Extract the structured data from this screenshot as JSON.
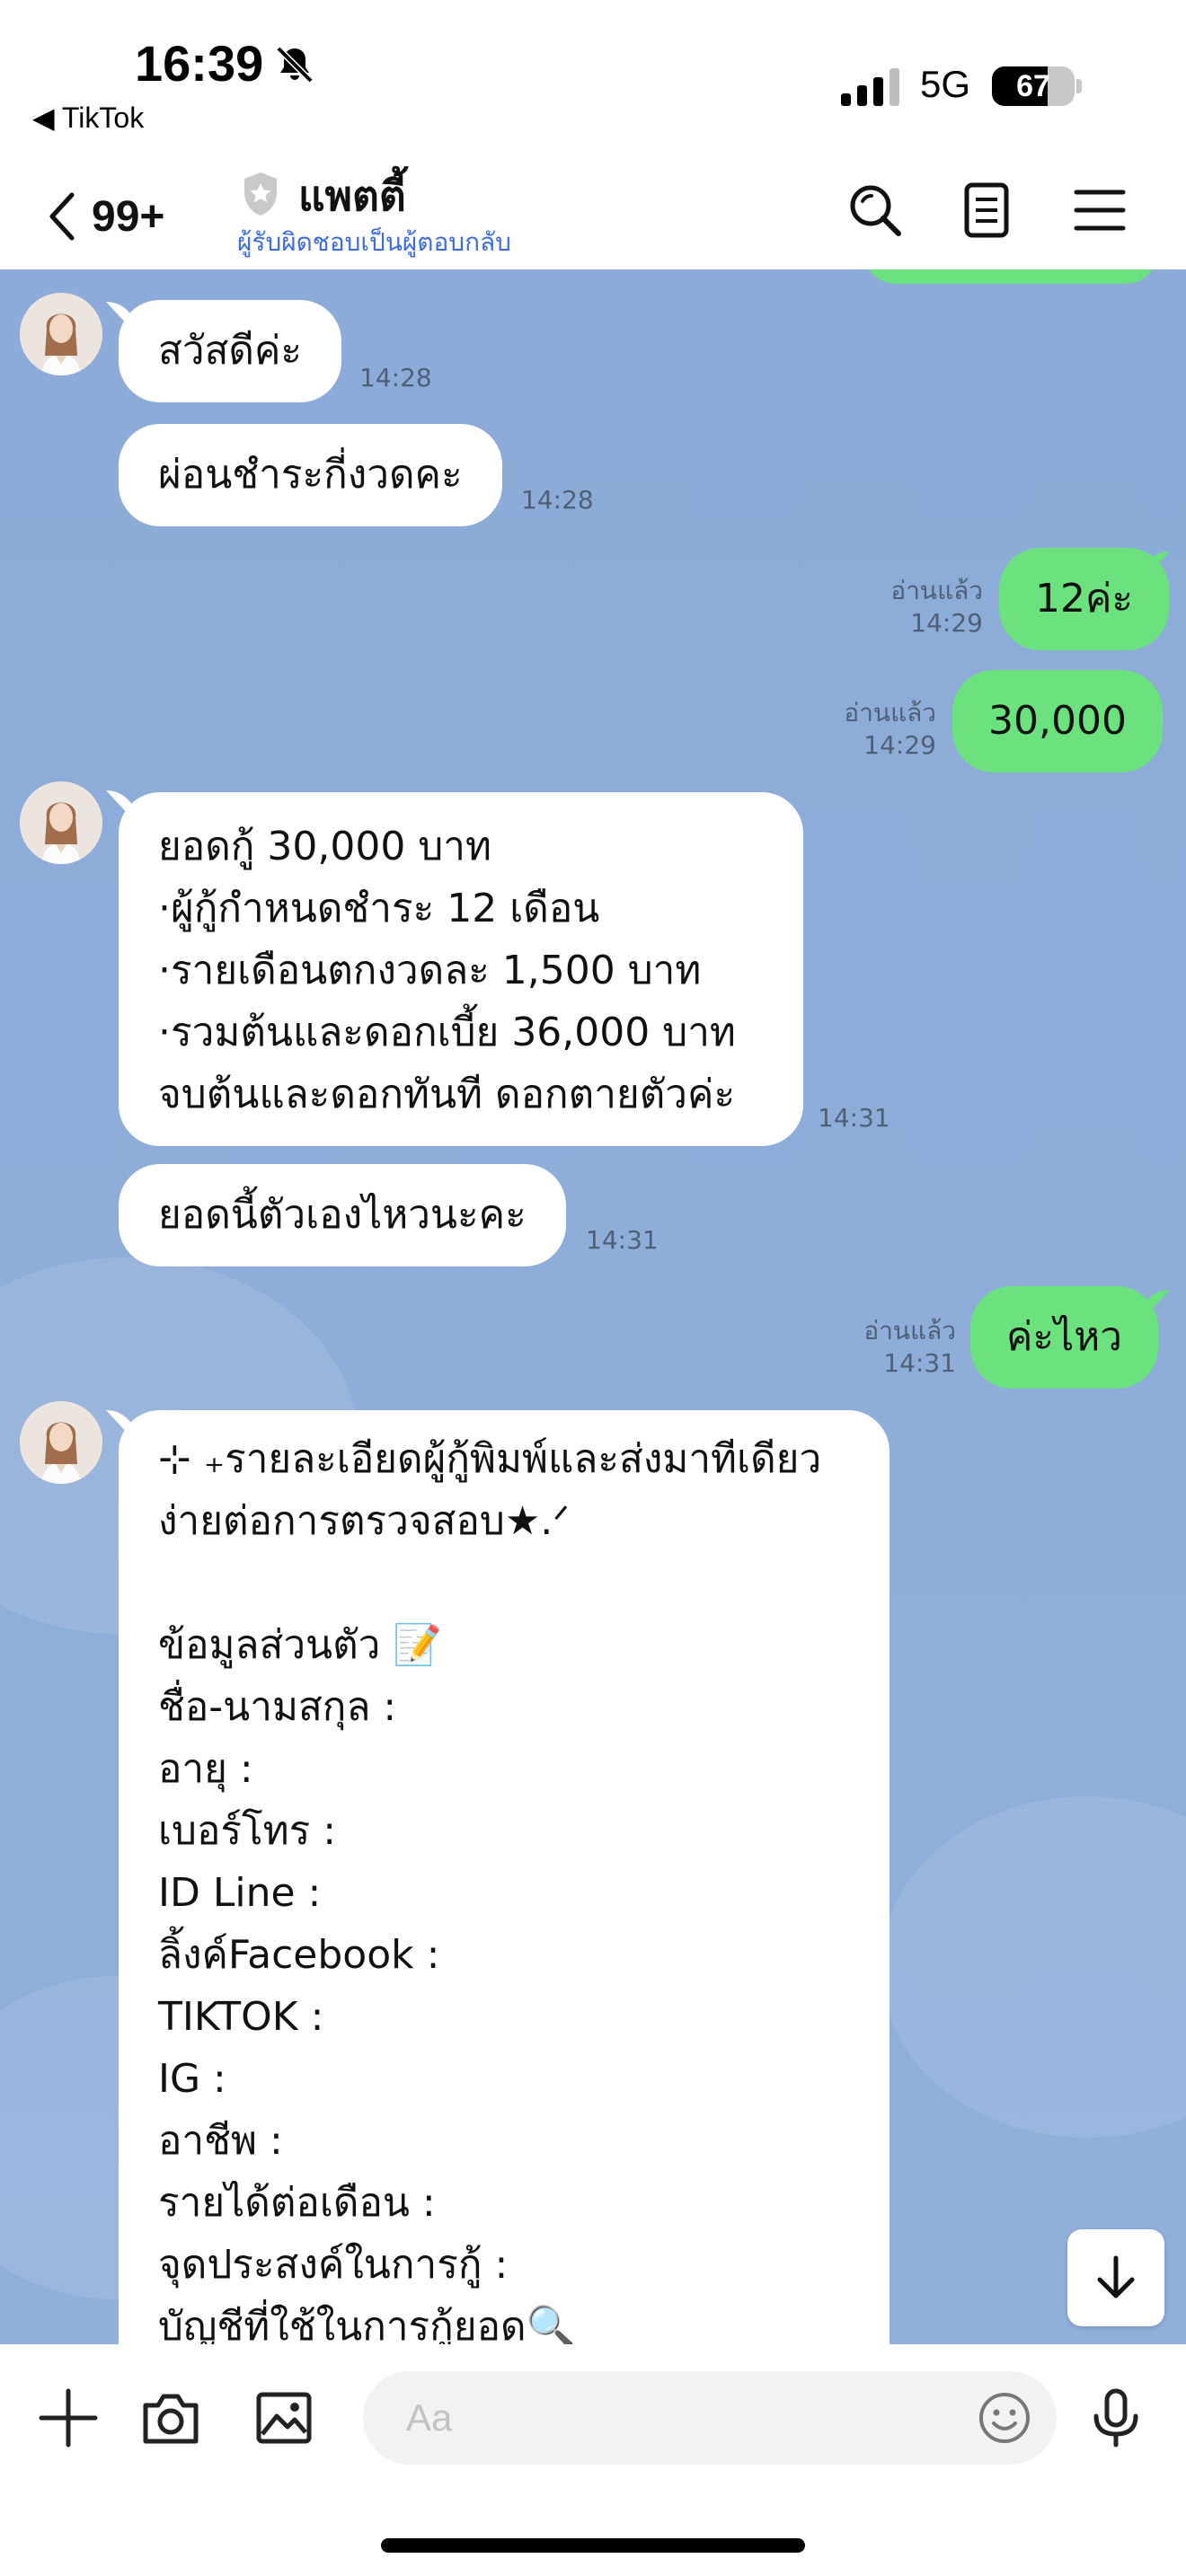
{
  "status_bar": {
    "time": "16:39",
    "back_app": "◀ TikTok",
    "network": "5G",
    "battery": "67",
    "battery_level": 0.67,
    "icons": [
      "bell-slash-icon",
      "signal-icon",
      "battery-icon"
    ]
  },
  "header": {
    "unread_count": "99+",
    "chat_name": "แพตตี้",
    "subtitle": "ผู้รับผิดชอบเป็นผู้ตอบกลับ",
    "icons": [
      "chevron-left-icon",
      "shield-icon",
      "search-icon",
      "notes-icon",
      "menu-icon"
    ]
  },
  "messages": [
    {
      "side": "in",
      "text": "สวัสดีค่ะ",
      "time": "14:28"
    },
    {
      "side": "in",
      "text": "ผ่อนชำระกี่งวดคะ",
      "time": "14:28"
    },
    {
      "side": "out",
      "text": "12ค่ะ",
      "read": "อ่านแล้ว",
      "time": "14:29"
    },
    {
      "side": "out",
      "text": "30,000",
      "read": "อ่านแล้ว",
      "time": "14:29"
    },
    {
      "side": "in",
      "lines": [
        "ยอดกู้  30,000 บาท",
        "·ผู้กู้กำหนดชำระ 12 เดือน",
        "·รายเดือนตกงวดละ 1,500 บาท",
        "·รวมต้นและดอกเบี้ย 36,000 บาท",
        "จบต้นและดอกทันที ดอกตายตัวค่ะ"
      ],
      "time": "14:31"
    },
    {
      "side": "in",
      "text": "ยอดนี้ตัวเองไหวนะคะ",
      "time": "14:31"
    },
    {
      "side": "out",
      "text": "ค่ะไหว",
      "read": "อ่านแล้ว",
      "time": "14:31"
    },
    {
      "side": "in",
      "lines": [
        "⊹ ₊รายละเอียดผู้กู้พิมพ์และส่งมาทีเดียว",
        "ง่ายต่อการตรวจสอบ★.ᐟ",
        "",
        "ข้อมูลส่วนตัว 📝",
        "ชื่อ-นามสกุล :",
        "อายุ  :",
        "เบอร์โทร  :",
        "ID Line :",
        "ลิ้งค์Facebook :",
        "TIKTOK :",
        "IG :",
        "อาชีพ :",
        "รายได้ต่อเดือน :",
        "จุดประสงค์ในการกู้ :",
        "บัญชีที่ใช้ในการกู้ยอด🔍"
      ]
    }
  ],
  "input": {
    "placeholder": "Aa",
    "icons": [
      "plus-icon",
      "camera-icon",
      "image-icon",
      "emoji-icon",
      "microphone-icon",
      "arrow-down-icon"
    ]
  }
}
